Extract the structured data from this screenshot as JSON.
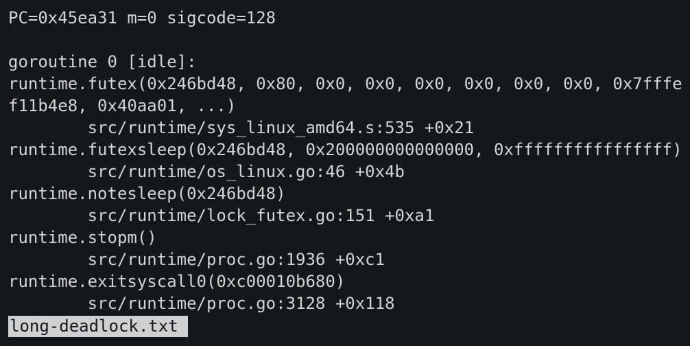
{
  "terminal": {
    "background_color": "#16171b",
    "text_color": "#d4d4d4",
    "lines": [
      "PC=0x45ea31 m=0 sigcode=128",
      "",
      "goroutine 0 [idle]:",
      "runtime.futex(0x246bd48, 0x80, 0x0, 0x0, 0x0, 0x0, 0x0, 0x0, 0x7fffe",
      "f11b4e8, 0x40aa01, ...)",
      "        src/runtime/sys_linux_amd64.s:535 +0x21",
      "runtime.futexsleep(0x246bd48, 0x200000000000000, 0xffffffffffffffff)",
      "        src/runtime/os_linux.go:46 +0x4b",
      "runtime.notesleep(0x246bd48)",
      "        src/runtime/lock_futex.go:151 +0xa1",
      "runtime.stopm()",
      "        src/runtime/proc.go:1936 +0xc1",
      "runtime.exitsyscall0(0xc00010b680)",
      "        src/runtime/proc.go:3128 +0x118"
    ]
  },
  "status_bar": {
    "filename": "long-deadlock.txt",
    "background_color": "#d0d0d0"
  }
}
